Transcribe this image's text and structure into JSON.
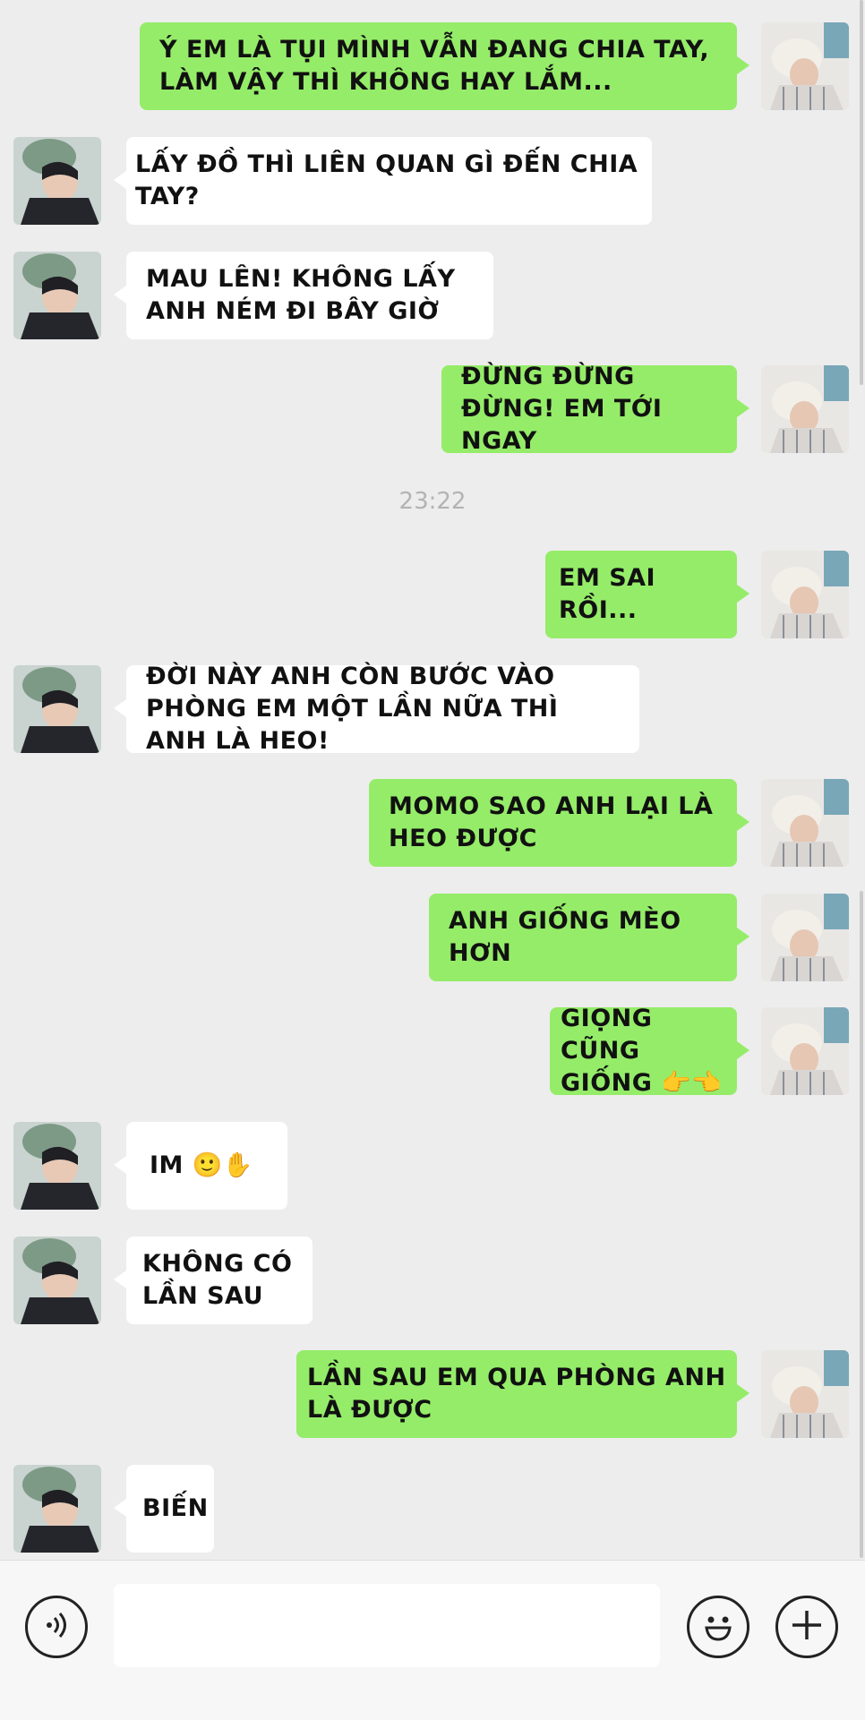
{
  "timestamp": "23:22",
  "messages": [
    {
      "from": "me",
      "text": "Ý EM LÀ TỤI MÌNH VẪN ĐANG CHIA TAY, LÀM VẬY THÌ KHÔNG HAY LẮM..."
    },
    {
      "from": "other",
      "text": "LẤY ĐỒ THÌ LIÊN QUAN GÌ ĐẾN CHIA TAY?"
    },
    {
      "from": "other",
      "text": "MAU LÊN! KHÔNG LẤY ANH NÉM ĐI BÂY GIỜ"
    },
    {
      "from": "me",
      "text": "ĐỪNG ĐỪNG ĐỪNG! EM TỚI NGAY"
    },
    {
      "from": "me",
      "text": "EM SAI RỒI..."
    },
    {
      "from": "other",
      "text": "ĐỜI NÀY ANH CÒN BƯỚC VÀO PHÒNG EM MỘT LẦN NỮA THÌ ANH LÀ HEO!"
    },
    {
      "from": "me",
      "text": "MOMO SAO ANH LẠI LÀ HEO ĐƯỢC"
    },
    {
      "from": "me",
      "text": "ANH GIỐNG MÈO HƠN"
    },
    {
      "from": "me",
      "text": "GIỌNG CŨNG GIỐNG 👉👈"
    },
    {
      "from": "other",
      "text": "IM 🙂✋"
    },
    {
      "from": "other",
      "text": "KHÔNG CÓ LẦN SAU"
    },
    {
      "from": "me",
      "text": "LẦN SAU EM QUA PHÒNG ANH LÀ ĐƯỢC"
    },
    {
      "from": "other",
      "text": "BIẾN"
    }
  ],
  "input_bar": {
    "voice_icon": "voice-icon",
    "emoji_icon": "emoji-icon",
    "add_icon": "plus-icon",
    "text_value": ""
  }
}
